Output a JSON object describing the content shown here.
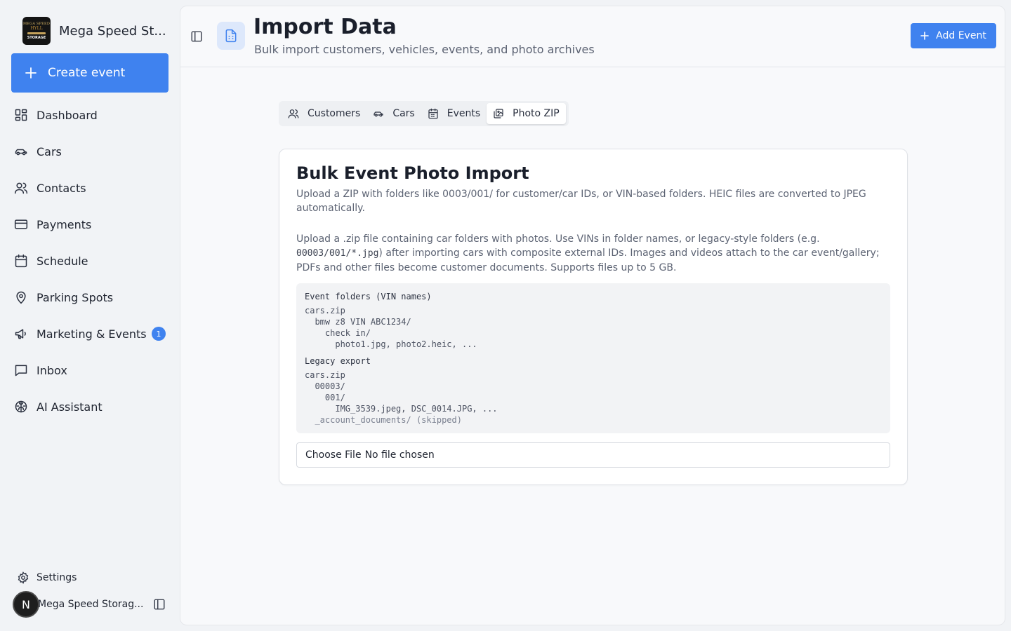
{
  "brand": {
    "name": "Mega Speed St...",
    "logo_text": [
      "MEGA SPEED",
      "HYLL",
      "STORAGE"
    ]
  },
  "sidebar": {
    "create_label": "Create event",
    "items": [
      {
        "label": "Dashboard",
        "icon": "dashboard-icon"
      },
      {
        "label": "Cars",
        "icon": "car-icon"
      },
      {
        "label": "Contacts",
        "icon": "users-icon"
      },
      {
        "label": "Payments",
        "icon": "credit-card-icon"
      },
      {
        "label": "Schedule",
        "icon": "calendar-icon"
      },
      {
        "label": "Parking Spots",
        "icon": "map-pin-icon"
      },
      {
        "label": "Marketing & Events",
        "icon": "megaphone-icon",
        "badge": "1"
      },
      {
        "label": "Inbox",
        "icon": "message-square-icon"
      },
      {
        "label": "AI Assistant",
        "icon": "brain-icon"
      }
    ],
    "settings_label": "Settings",
    "account": {
      "avatar_letter": "N",
      "name": "Mega Speed Storag..."
    }
  },
  "header": {
    "title": "Import Data",
    "subtitle": "Bulk import customers, vehicles, events, and photo archives",
    "add_event_label": "Add Event"
  },
  "tabs": [
    {
      "label": "Customers",
      "icon": "users-icon",
      "active": false
    },
    {
      "label": "Cars",
      "icon": "car-icon",
      "active": false
    },
    {
      "label": "Events",
      "icon": "calendar-icon",
      "active": false
    },
    {
      "label": "Photo ZIP",
      "icon": "images-icon",
      "active": true
    }
  ],
  "card": {
    "title": "Bulk Event Photo Import",
    "description": "Upload a ZIP with folders like 0003/001/ for customer/car IDs, or VIN-based folders. HEIC files are converted to JPEG automatically.",
    "body_part1": "Upload a .zip file containing car folders with photos. Use VINs in folder names, or legacy-style folders (e.g. ",
    "body_code": "00003/001/*.jpg",
    "body_part2": ") after importing cars with composite external IDs. Images and videos attach to the car event/gallery; PDFs and other files become customer documents. Supports files up to 5 GB.",
    "example1": {
      "heading": "Event folders (VIN names)",
      "lines": [
        "cars.zip",
        "  bmw z8 VIN ABC1234/",
        "    check in/",
        "      photo1.jpg, photo2.heic, ..."
      ]
    },
    "example2": {
      "heading": "Legacy export",
      "lines": [
        "cars.zip",
        "  00003/",
        "    001/",
        "      IMG_3539.jpeg, DSC_0014.JPG, ...",
        "  _account_documents/ (skipped)"
      ]
    },
    "file_input": {
      "button": "Choose File",
      "status": "No file chosen"
    }
  },
  "colors": {
    "accent": "#3f82ef",
    "page_bg": "#f1f3f6",
    "panel_bg": "#f8f9fb",
    "icon_tile_bg": "#dde8fb"
  }
}
